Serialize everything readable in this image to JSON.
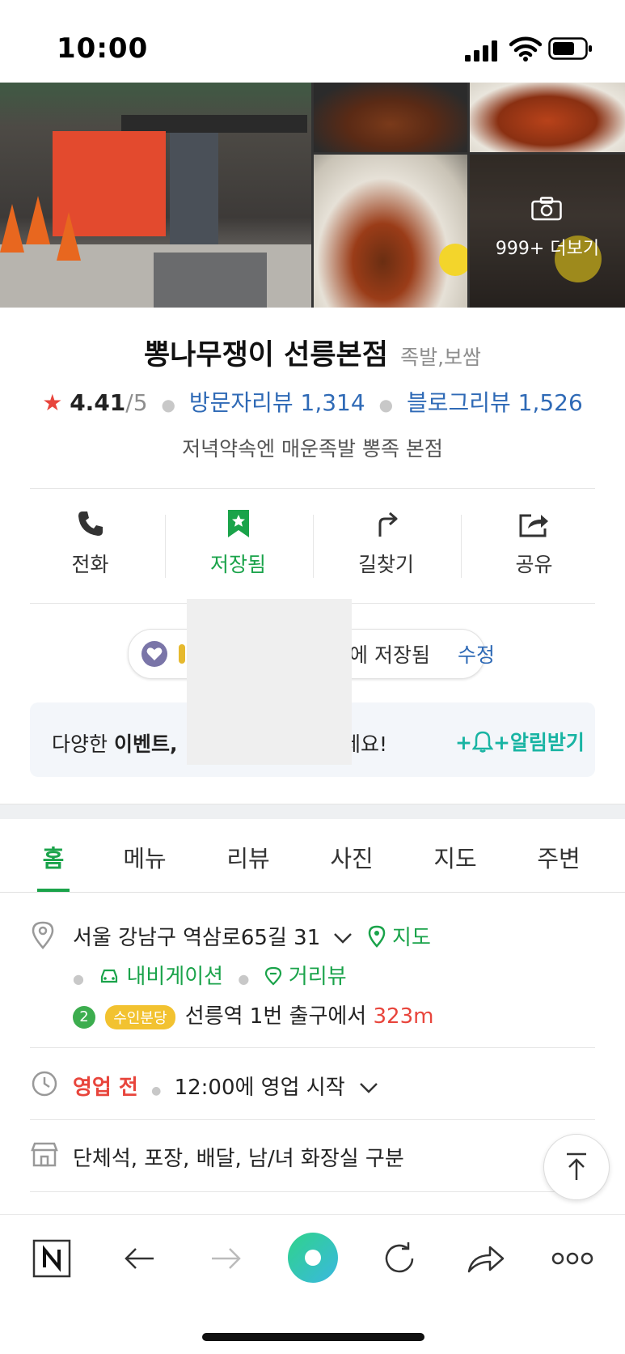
{
  "status_bar": {
    "time": "10:00"
  },
  "photos": {
    "more_label": "999+ 더보기"
  },
  "place": {
    "name": "뽕나무쟁이 선릉본점",
    "category": "족발,보쌈",
    "rating": "4.41",
    "rating_max": "/5",
    "visitor_reviews": "방문자리뷰 1,314",
    "blog_reviews": "블로그리뷰 1,526",
    "description": "저녁약속엔 매운족발 뽕족 본점"
  },
  "actions": [
    {
      "label": "전화"
    },
    {
      "label": "저장됨"
    },
    {
      "label": "길찾기"
    },
    {
      "label": "공유"
    }
  ],
  "saved": {
    "text": "에 저장됨",
    "edit": "수정"
  },
  "banner": {
    "text_prefix": "다양한 ",
    "text_bold": "이벤트,",
    "text_tail": "보세요!",
    "action": "+알림받기"
  },
  "tabs": [
    "홈",
    "메뉴",
    "리뷰",
    "사진",
    "지도",
    "주변"
  ],
  "info": {
    "address": "서울 강남구 역삼로65길 31",
    "map_link": "지도",
    "navigation": "내비게이션",
    "street_view": "거리뷰",
    "subway_line_number": "2",
    "subway_line_name": "수인분당",
    "station_text": "선릉역 1번 출구에서",
    "distance": "323m",
    "status": "영업 전",
    "open_text": "12:00에 영업 시작",
    "facilities": "단체석, 포장, 배달, 남/녀 화장실 구분"
  },
  "colors": {
    "accent_green": "#1aa34a",
    "link_blue": "#2f6ab6",
    "red": "#e8453c",
    "teal": "#19b4a3"
  }
}
